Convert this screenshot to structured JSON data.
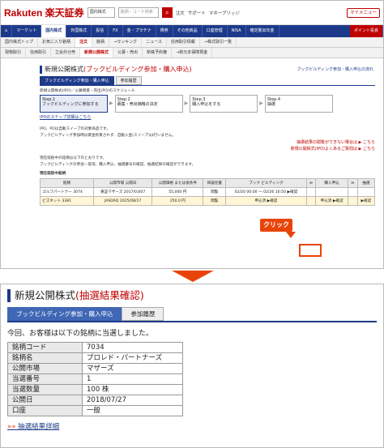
{
  "header": {
    "logo": "Rakuten 楽天証券",
    "market_select": "国内株式",
    "search_placeholder": "銘柄・コード検索",
    "links": [
      "注文",
      "サポート",
      "マネーブリッジ"
    ],
    "mypage": "マイメニュー"
  },
  "nav1": [
    "マーケット",
    "国内株式",
    "外国株式",
    "投信",
    "FX",
    "金・プラチナ",
    "債券",
    "その他商品",
    "口座管理",
    "NISA",
    "確定拠出年金",
    "ポイント投資"
  ],
  "nav2": [
    "国内株式トップ",
    "お気に入り銘柄",
    "注文",
    "銘柄",
    "→ランキング",
    "ニュース",
    "信用取引情報",
    "→株式取引一覧"
  ],
  "nav3": [
    "現物取引",
    "信用取引",
    "立会外分売",
    "新規公開株式",
    "公募・売出",
    "新株予約権",
    "→新元本保障預金"
  ],
  "page": {
    "title": "新規公開株式",
    "title_red": "(ブックビルディング参加・購入申込)",
    "flow_link": "ブックビルディング参加・購入申込の流れ",
    "tabs": [
      "ブックビルディング参加・購入申込",
      "参加履歴"
    ],
    "crumb": "新規公開株式(IPO)／公募増資・売出(PO)のスケジュール"
  },
  "steps": [
    {
      "title": "Step.1",
      "desc": "ブックビルディングに参加する"
    },
    {
      "title": "Step.2",
      "desc": "募集・売出価格の決定"
    },
    {
      "title": "Step.3",
      "desc": "購入申込をする"
    },
    {
      "title": "Step.4",
      "desc": "抽選"
    }
  ],
  "ipo_link": "IPOのステップ詳細はこちら",
  "notes": [
    "IPO、POは自動スイープの対象商品です。",
    "ブックビルディング参加時は資金拘束されず、自動入金(スイープ)は行いません。"
  ],
  "right_notes": [
    "抽選結果の閲覧ができない場合は ▶ こちら",
    "新規公開株式(IPO)よくあるご質問は ▶ こちら"
  ],
  "list_intro": [
    "現在取扱中の銘柄は以下のとおりです。",
    "ブックビルディングの参加・取消、購入申込、抽選番号の確認、抽選結果の確認ができます。"
  ],
  "list_heading": "現在取扱中銘柄",
  "table": {
    "headers": [
      "銘柄",
      "公開市場 公開日",
      "公開価格 または仮条件",
      "目論見書",
      "ブック ビルディング",
      "≫",
      "購入申込",
      "≫",
      "抽選"
    ],
    "rows": [
      [
        "ゴルフパートナー 3074",
        "東証マザーズ 2017/03/07",
        "55,000 円",
        "閲覧",
        "02/20 00:00 〜 02/26 16:50 ▶確認",
        "",
        "",
        "",
        ""
      ],
      [
        "ビズネット 3381",
        "JASDAQ 2025/08/17",
        "250.0 円",
        "閲覧",
        "申込済 ▶確認",
        "",
        "申込済 ▶確認",
        "",
        "▶確認"
      ]
    ]
  },
  "click_label": "クリック",
  "result": {
    "title": "新規公開株式",
    "title_red": "(抽選結果確認)",
    "tabs": [
      "ブックビルディング参加・購入申込",
      "参加履歴"
    ],
    "message": "今回、お客様は以下の銘柄に当選しました。",
    "rows": [
      {
        "k": "銘柄コード",
        "v": "7034"
      },
      {
        "k": "銘柄名",
        "v": "プロレド・パートナーズ"
      },
      {
        "k": "公開市場",
        "v": "マザーズ"
      },
      {
        "k": "当選番号",
        "v": "1"
      },
      {
        "k": "当選数量",
        "v": "100 株"
      },
      {
        "k": "公開日",
        "v": "2018/07/27"
      },
      {
        "k": "口座",
        "v": "一般"
      }
    ],
    "detail_link": "抽選結果詳細"
  }
}
